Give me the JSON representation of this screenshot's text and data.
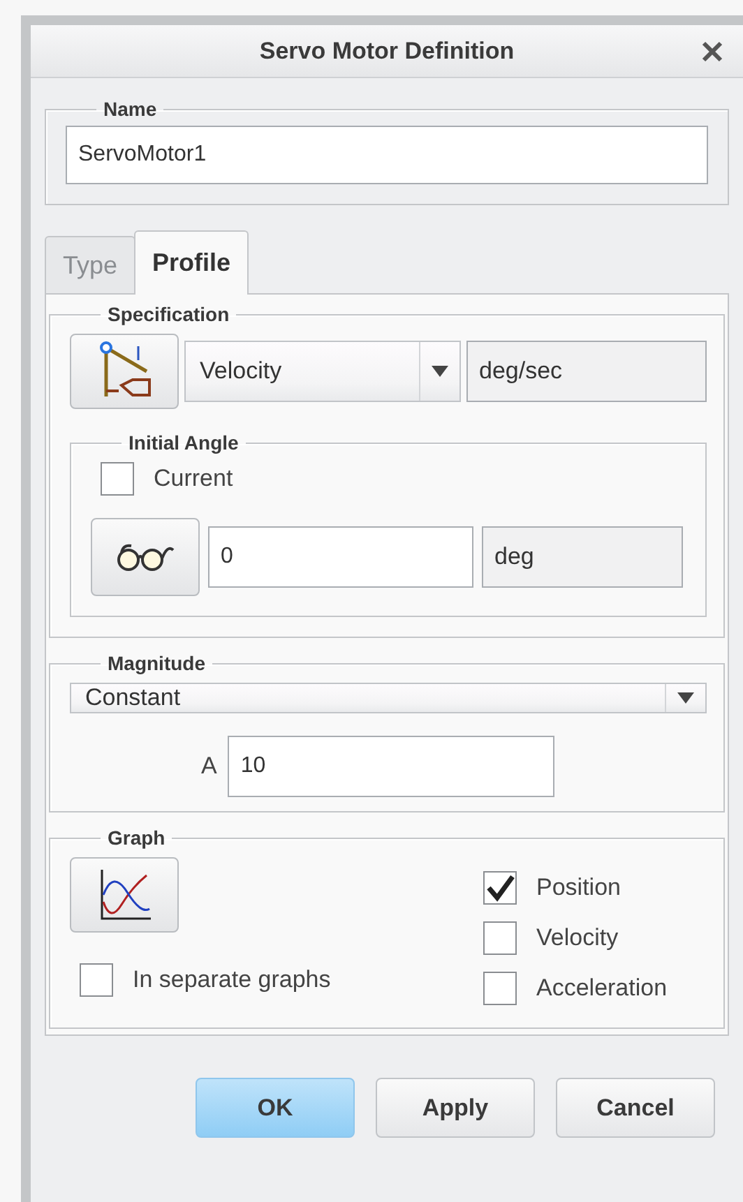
{
  "window": {
    "title": "Servo Motor Definition"
  },
  "name_group": {
    "legend": "Name",
    "value": "ServoMotor1"
  },
  "tabs": [
    {
      "label": "Type",
      "selected": false
    },
    {
      "label": "Profile",
      "selected": true
    }
  ],
  "specification": {
    "legend": "Specification",
    "type": "Velocity",
    "unit": "deg/sec"
  },
  "initial_angle": {
    "legend": "Initial Angle",
    "current": {
      "label": "Current",
      "checked": false
    },
    "value": "0",
    "unit": "deg"
  },
  "magnitude": {
    "legend": "Magnitude",
    "function": "Constant",
    "parameter": "A",
    "value": "10"
  },
  "graph": {
    "legend": "Graph",
    "separate": {
      "label": "In separate graphs",
      "checked": false
    },
    "quantities": [
      {
        "label": "Position",
        "checked": true
      },
      {
        "label": "Velocity",
        "checked": false
      },
      {
        "label": "Acceleration",
        "checked": false
      }
    ]
  },
  "buttons": [
    {
      "label": "OK",
      "kind": "primary"
    },
    {
      "label": "Apply",
      "kind": "default"
    },
    {
      "label": "Cancel",
      "kind": "default"
    }
  ]
}
